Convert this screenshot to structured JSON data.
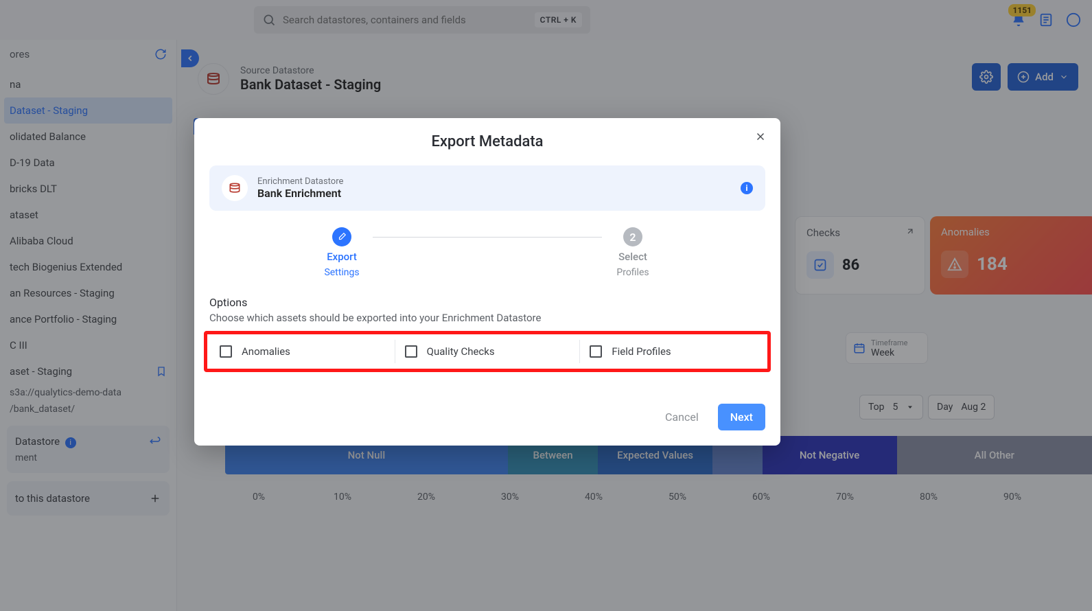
{
  "topbar": {
    "search_placeholder": "Search datastores, containers and fields",
    "kbd": "CTRL + K",
    "notification_count": "1151"
  },
  "sidebar": {
    "header": "ores",
    "items": [
      "na",
      "Dataset - Staging",
      "olidated Balance",
      "D-19 Data",
      "bricks DLT",
      "ataset",
      "Alibaba Cloud",
      "tech Biogenius Extended",
      "an Resources - Staging",
      "ance Portfolio - Staging",
      "C III",
      "aset - Staging"
    ],
    "path_line1": "s3a://qualytics-demo-data",
    "path_line2": "/bank_dataset/",
    "enrich_card_label": "Datastore",
    "enrich_card_sub": "ment",
    "add_label": "to this datastore"
  },
  "main": {
    "sup": "Source Datastore",
    "name": "Bank Dataset - Staging",
    "add_label": "Add",
    "checks": {
      "label": "Checks",
      "value": "86"
    },
    "anomalies": {
      "label": "Anomalies",
      "value": "184"
    },
    "timeframe_label": "Timeframe",
    "timeframe_value": "Week",
    "top_label": "Top",
    "top_value": "5",
    "day_label": "Day",
    "day_value": "Aug 2"
  },
  "chart_data": {
    "type": "bar",
    "stacked": true,
    "orientation": "horizontal",
    "series": [
      {
        "name": "Not Null",
        "value": 33
      },
      {
        "name": "Between",
        "value": 10
      },
      {
        "name": "Expected Values",
        "value": 13
      },
      {
        "name": "",
        "value": 6
      },
      {
        "name": "Not Negative",
        "value": 16
      },
      {
        "name": "All Other",
        "value": 22
      }
    ],
    "xticks": [
      "0%",
      "10%",
      "20%",
      "30%",
      "40%",
      "50%",
      "60%",
      "70%",
      "80%",
      "90%"
    ],
    "xlabel": "",
    "ylabel": "",
    "title": ""
  },
  "modal": {
    "title": "Export Metadata",
    "enrich_sup": "Enrichment Datastore",
    "enrich_name": "Bank Enrichment",
    "step1_title": "Export",
    "step1_sub": "Settings",
    "step2_num": "2",
    "step2_title": "Select",
    "step2_sub": "Profiles",
    "options_label": "Options",
    "options_desc": "Choose which assets should be exported into your Enrichment Datastore",
    "opt_anomalies": "Anomalies",
    "opt_quality": "Quality Checks",
    "opt_profiles": "Field Profiles",
    "cancel": "Cancel",
    "next": "Next"
  }
}
